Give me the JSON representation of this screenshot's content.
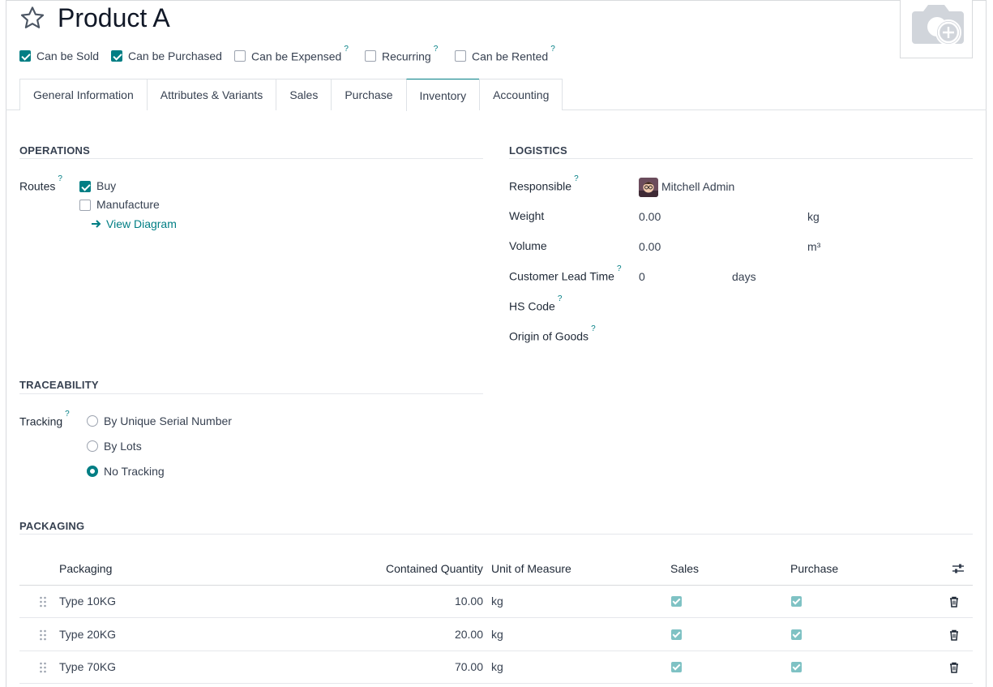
{
  "product": {
    "name": "Product A"
  },
  "flags": [
    {
      "label": "Can be Sold",
      "checked": true,
      "help": ""
    },
    {
      "label": "Can be Purchased",
      "checked": true,
      "help": ""
    },
    {
      "label": "Can be Expensed",
      "checked": false,
      "help": "?"
    },
    {
      "label": "Recurring",
      "checked": false,
      "help": "?"
    },
    {
      "label": "Can be Rented",
      "checked": false,
      "help": "?"
    }
  ],
  "tabs": [
    {
      "label": "General Information"
    },
    {
      "label": "Attributes & Variants"
    },
    {
      "label": "Sales"
    },
    {
      "label": "Purchase"
    },
    {
      "label": "Inventory",
      "active": true
    },
    {
      "label": "Accounting"
    }
  ],
  "operations": {
    "title": "OPERATIONS",
    "routes_label": "Routes",
    "help": "?",
    "routes": [
      {
        "label": "Buy",
        "checked": true
      },
      {
        "label": "Manufacture",
        "checked": false
      }
    ],
    "view_diagram": "View Diagram"
  },
  "logistics": {
    "title": "LOGISTICS",
    "help": "?",
    "responsible_label": "Responsible",
    "responsible_value": "Mitchell Admin",
    "weight_label": "Weight",
    "weight_value": "0.00",
    "weight_unit": "kg",
    "volume_label": "Volume",
    "volume_value": "0.00",
    "volume_unit": "m³",
    "lead_label": "Customer Lead Time",
    "lead_value": "0",
    "lead_unit": "days",
    "hs_label": "HS Code",
    "origin_label": "Origin of Goods"
  },
  "traceability": {
    "title": "TRACEABILITY",
    "tracking_label": "Tracking",
    "help": "?",
    "options": [
      {
        "label": "By Unique Serial Number",
        "selected": false
      },
      {
        "label": "By Lots",
        "selected": false
      },
      {
        "label": "No Tracking",
        "selected": true
      }
    ]
  },
  "packaging": {
    "title": "PACKAGING",
    "columns": {
      "packaging": "Packaging",
      "qty": "Contained Quantity",
      "uom": "Unit of Measure",
      "sales": "Sales",
      "purchase": "Purchase"
    },
    "rows": [
      {
        "name": "Type 10KG",
        "qty": "10.00",
        "uom": "kg",
        "sales": true,
        "purchase": true
      },
      {
        "name": "Type 20KG",
        "qty": "20.00",
        "uom": "kg",
        "sales": true,
        "purchase": true
      },
      {
        "name": "Type 70KG",
        "qty": "70.00",
        "uom": "kg",
        "sales": true,
        "purchase": true
      }
    ]
  },
  "colors": {
    "accent": "#017e84",
    "border": "#d8dadd"
  }
}
